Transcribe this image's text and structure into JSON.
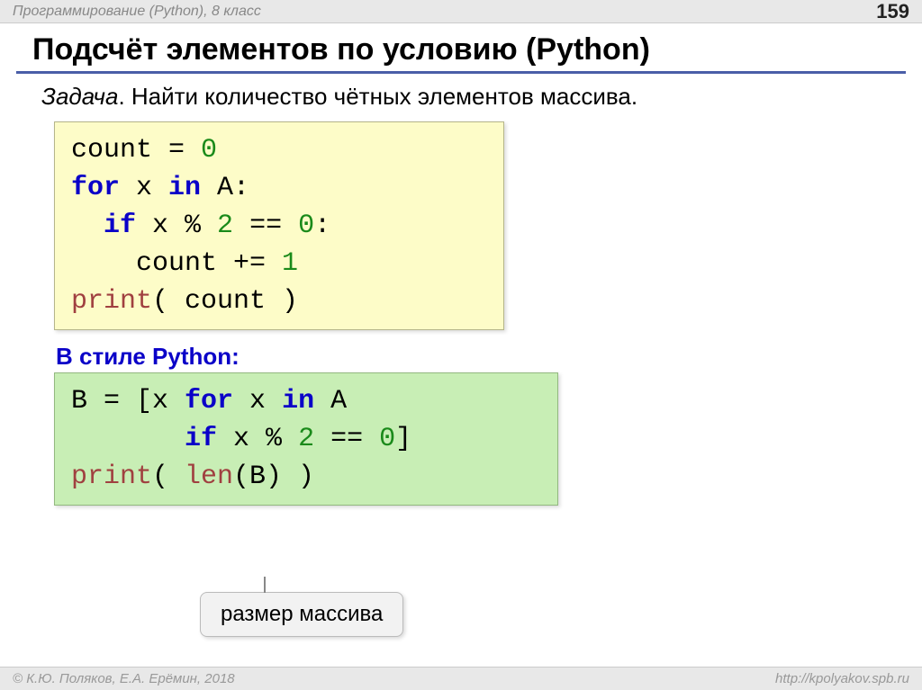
{
  "header": {
    "course": "Программирование (Python), 8 класс",
    "page": "159"
  },
  "title": "Подсчёт элементов по условию (Python)",
  "task": {
    "label": "Задача",
    "text": ". Найти количество чётных элементов массива."
  },
  "code1": {
    "tokens": [
      [
        {
          "t": "count = ",
          "c": "plain"
        },
        {
          "t": "0",
          "c": "num"
        }
      ],
      [
        {
          "t": "for",
          "c": "kw"
        },
        {
          "t": " x ",
          "c": "plain"
        },
        {
          "t": "in",
          "c": "kw"
        },
        {
          "t": " A:",
          "c": "plain"
        }
      ],
      [
        {
          "t": "  ",
          "c": "plain"
        },
        {
          "t": "if",
          "c": "kw"
        },
        {
          "t": " x % ",
          "c": "plain"
        },
        {
          "t": "2",
          "c": "num"
        },
        {
          "t": " == ",
          "c": "plain"
        },
        {
          "t": "0",
          "c": "num"
        },
        {
          "t": ":",
          "c": "plain"
        }
      ],
      [
        {
          "t": "    count += ",
          "c": "plain"
        },
        {
          "t": "1",
          "c": "num"
        }
      ],
      [
        {
          "t": "print",
          "c": "fn"
        },
        {
          "t": "( count )",
          "c": "plain"
        }
      ]
    ]
  },
  "section2_label": "В стиле Python:",
  "code2": {
    "tokens": [
      [
        {
          "t": "B = [x ",
          "c": "plain"
        },
        {
          "t": "for",
          "c": "kw"
        },
        {
          "t": " x ",
          "c": "plain"
        },
        {
          "t": "in",
          "c": "kw"
        },
        {
          "t": " A",
          "c": "plain"
        }
      ],
      [
        {
          "t": "       ",
          "c": "plain"
        },
        {
          "t": "if",
          "c": "kw"
        },
        {
          "t": " x % ",
          "c": "plain"
        },
        {
          "t": "2",
          "c": "num"
        },
        {
          "t": " == ",
          "c": "plain"
        },
        {
          "t": "0",
          "c": "num"
        },
        {
          "t": "]",
          "c": "plain"
        }
      ],
      [
        {
          "t": "print",
          "c": "fn"
        },
        {
          "t": "( ",
          "c": "plain"
        },
        {
          "t": "len",
          "c": "fn"
        },
        {
          "t": "(B) )",
          "c": "plain"
        }
      ]
    ]
  },
  "callout": "размер массива",
  "footer": {
    "left": "© К.Ю. Поляков, Е.А. Ерёмин, 2018",
    "right": "http://kpolyakov.spb.ru"
  }
}
